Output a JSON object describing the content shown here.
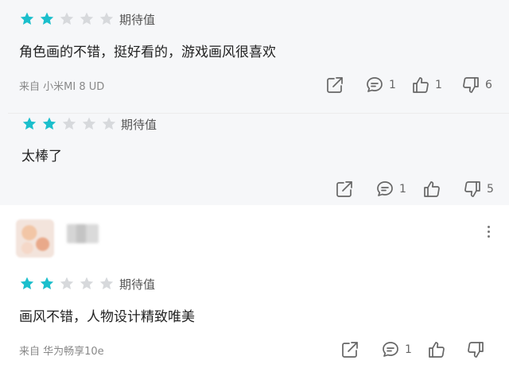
{
  "reviews": [
    {
      "rating": 2,
      "max_rating": 5,
      "rating_label": "期待值",
      "text": "角色画的不错，挺好看的，游戏画风很喜欢",
      "device": "来自 小米MI 8 UD",
      "comments": "1",
      "likes": "1",
      "dislikes": "6"
    },
    {
      "rating": 2,
      "max_rating": 5,
      "rating_label": "期待值",
      "text": "太棒了",
      "comments": "1",
      "dislikes": "5"
    },
    {
      "rating": 2,
      "max_rating": 5,
      "rating_label": "期待值",
      "text": "画风不错，人物设计精致唯美",
      "device": "来自 华为畅享10e",
      "comments": "1"
    }
  ],
  "colors": {
    "star_filled": "#1bbfcc",
    "star_empty": "#d7d9dc"
  },
  "icons": [
    "share-icon",
    "comment-icon",
    "thumbs-up-icon",
    "thumbs-down-icon",
    "more-vertical-icon"
  ]
}
